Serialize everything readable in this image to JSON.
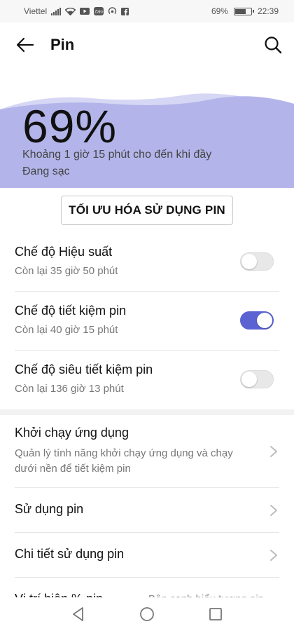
{
  "status_bar": {
    "carrier": "Viettel",
    "battery_percent": "69%",
    "battery_level": 0.69,
    "time": "22:39",
    "icons": [
      "signal-icon",
      "wifi-icon",
      "youtube-icon",
      "zalo-icon",
      "hotspot-icon",
      "facebook-icon",
      "battery-icon"
    ]
  },
  "header": {
    "title": "Pin",
    "back_icon": "arrow-left-icon",
    "search_icon": "search-icon"
  },
  "battery": {
    "percent": "69%",
    "time_to_full": "Khoảng 1 giờ 15 phút cho đến khi đầy",
    "status": "Đang sạc",
    "wave_color": "#b3b5ea"
  },
  "optimize": {
    "label": "TỐI ƯU HÓA SỬ DỤNG PIN"
  },
  "modes": [
    {
      "label": "Chế độ Hiệu suất",
      "sub": "Còn lại 35 giờ 50 phút",
      "enabled": false
    },
    {
      "label": "Chế độ tiết kiệm pin",
      "sub": "Còn lại 40 giờ 15 phút",
      "enabled": true
    },
    {
      "label": "Chế độ siêu tiết kiệm pin",
      "sub": "Còn lại 136 giờ 13 phút",
      "enabled": false
    }
  ],
  "settings": [
    {
      "label": "Khởi chạy ứng dụng",
      "desc": "Quản lý tính năng khởi chạy ứng dụng và chạy dưới nền để tiết kiệm pin"
    },
    {
      "label": "Sử dụng pin"
    },
    {
      "label": "Chi tiết sử dụng pin"
    },
    {
      "label": "Vị trí hiện % pin",
      "value": "Bên cạnh biểu tượng pin"
    }
  ],
  "navbar": {
    "icons": [
      "back-triangle-icon",
      "home-circle-icon",
      "recents-square-icon"
    ]
  },
  "colors": {
    "accent": "#5b63d3",
    "hero_wave": "#b3b5ea"
  }
}
